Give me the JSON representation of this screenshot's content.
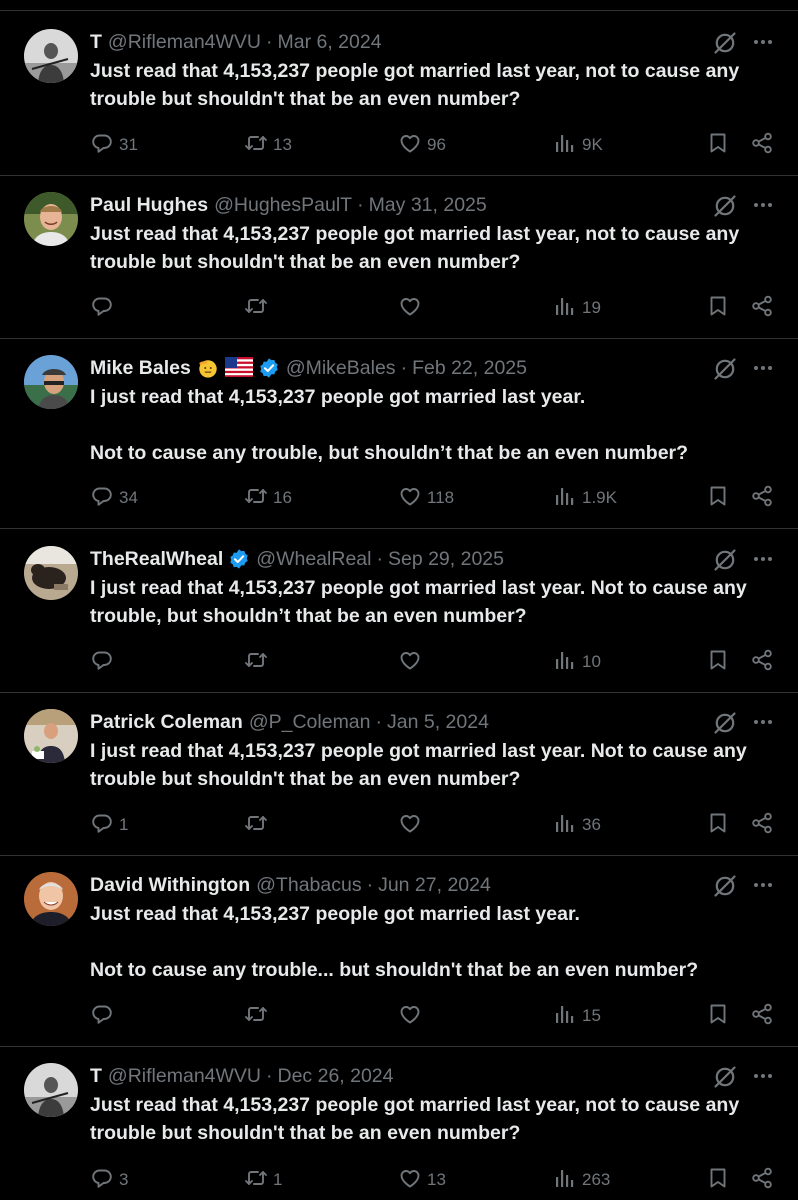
{
  "tweets": [
    {
      "name": "T",
      "handle": "@Rifleman4WVU",
      "sep": "·",
      "date": "Mar 6, 2024",
      "text": [
        "Just read that 4,153,237 people got married last year, not to cause any trouble but shouldn't that be an even number?"
      ],
      "replies": "31",
      "retweets": "13",
      "likes": "96",
      "views": "9K",
      "verified": false,
      "emojis": [],
      "avatar_icon": "person-with-rifle-avatar"
    },
    {
      "name": "Paul Hughes",
      "handle": "@HughesPaulT",
      "sep": "·",
      "date": "May 31, 2025",
      "text": [
        "Just read that 4,153,237 people got married last year, not to cause any trouble but shouldn't that be an even number?"
      ],
      "replies": "",
      "retweets": "",
      "likes": "",
      "views": "19",
      "verified": false,
      "emojis": [],
      "avatar_icon": "smiling-man-avatar"
    },
    {
      "name": "Mike Bales",
      "handle": "@MikeBales",
      "sep": "·",
      "date": "Feb 22, 2025",
      "text": [
        "I just read that 4,153,237 people got married last year.",
        "Not to cause any trouble, but shouldn’t that be an even number?"
      ],
      "replies": "34",
      "retweets": "16",
      "likes": "118",
      "views": "1.9K",
      "verified": true,
      "emojis": [
        "saluting-face-emoji",
        "us-flag-emoji"
      ],
      "avatar_icon": "man-with-cap-avatar"
    },
    {
      "name": "TheRealWheal",
      "handle": "@WhealReal",
      "sep": "·",
      "date": "Sep 29, 2025",
      "text": [
        "I just read that 4,153,237 people got married last year. Not to cause any trouble, but shouldn’t that be an even number?"
      ],
      "replies": "",
      "retweets": "",
      "likes": "",
      "views": "10",
      "verified": true,
      "emojis": [],
      "avatar_icon": "dark-animal-avatar"
    },
    {
      "name": "Patrick Coleman",
      "handle": "@P_Coleman",
      "sep": "·",
      "date": "Jan 5, 2024",
      "text": [
        "I just read that 4,153,237 people got married last year. Not to cause any trouble but shouldn't that be an even number?"
      ],
      "replies": "1",
      "retweets": "",
      "likes": "",
      "views": "36",
      "verified": false,
      "emojis": [],
      "avatar_icon": "man-in-suit-avatar"
    },
    {
      "name": "David Withington",
      "handle": "@Thabacus",
      "sep": "·",
      "date": "Jun 27, 2024",
      "text": [
        "Just read that 4,153,237 people got married last year.",
        "Not to cause any trouble... but shouldn't that be an even number?"
      ],
      "replies": "",
      "retweets": "",
      "likes": "",
      "views": "15",
      "verified": false,
      "emojis": [],
      "avatar_icon": "smiling-older-man-avatar"
    },
    {
      "name": "T",
      "handle": "@Rifleman4WVU",
      "sep": "·",
      "date": "Dec 26, 2024",
      "text": [
        "Just read that 4,153,237 people got married last year, not to cause any trouble but shouldn't that be an even number?"
      ],
      "replies": "3",
      "retweets": "1",
      "likes": "13",
      "views": "263",
      "verified": false,
      "emojis": [],
      "avatar_icon": "person-with-rifle-avatar"
    }
  ],
  "colors": {
    "background": "#000000",
    "text": "#e7e9ea",
    "muted": "#71767b",
    "divider": "#2f3336",
    "verified": "#1d9bf0"
  }
}
